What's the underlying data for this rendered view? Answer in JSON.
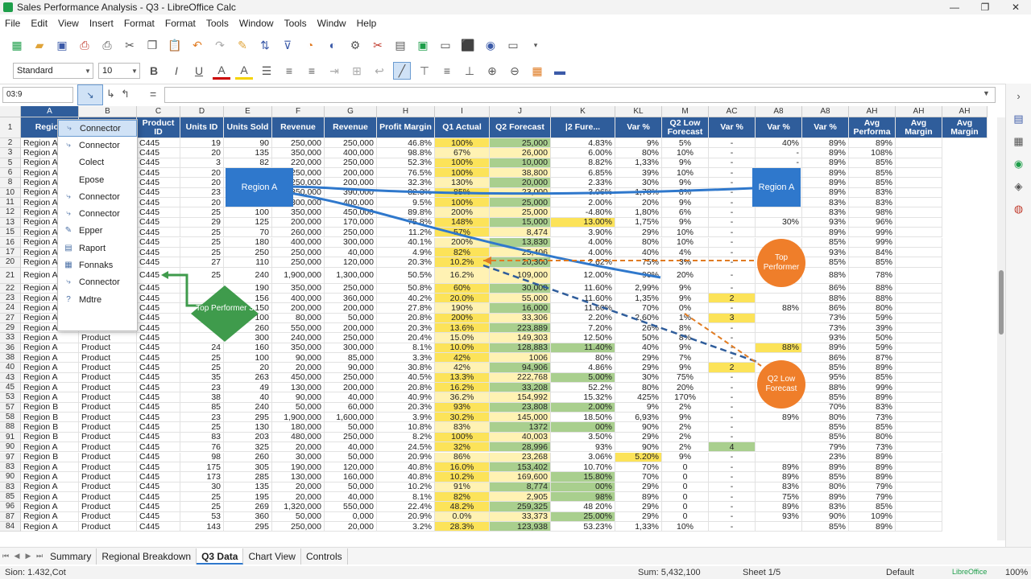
{
  "window": {
    "title": "Sales Performance Analysis - Q3 - LibreOffice Calc"
  },
  "menu": [
    "File",
    "Edit",
    "View",
    "Insert",
    "Format",
    "Format",
    "Tools",
    "Window",
    "Tools",
    "Windw",
    "Help"
  ],
  "toolbar2": {
    "style": "Standard",
    "font_size": "10"
  },
  "formula": {
    "namebox": "03:9",
    "equals": "="
  },
  "columns": [
    "A",
    "B",
    "C",
    "D",
    "E",
    "F",
    "G",
    "H",
    "I",
    "J",
    "K",
    "KL",
    "M",
    "AC",
    "A8",
    "A8",
    "AH",
    "AH",
    "AH"
  ],
  "header_row": [
    "Region",
    "",
    "Product ID",
    "Units ID",
    "Units Sold",
    "Revenue",
    "Revenue",
    "Profit Margin",
    "Q1 Actual",
    "Q2 Forecast",
    "|2 Fure...",
    "Var %",
    "Q2 Low Forecast",
    "Var %",
    "Var %",
    "Var %",
    "Avg Performa",
    "Avg Margin",
    "Avg Margin"
  ],
  "row_numbers": [
    "1",
    "2",
    "3",
    "5",
    "6",
    "8",
    "10",
    "11",
    "12",
    "13",
    "15",
    "16",
    "17",
    "20",
    "21",
    "22",
    "23",
    "24",
    "27",
    "29",
    "33",
    "36",
    "38",
    "40",
    "43",
    "45",
    "53",
    "57",
    "58",
    "88",
    "91",
    "90",
    "97",
    "83",
    "90",
    "83",
    "85",
    "96",
    "87",
    "84"
  ],
  "rows": [
    [
      "Region A",
      "",
      "C445",
      "19",
      "90",
      "250,000",
      "250,000",
      "46.8%",
      "100%",
      "25,000",
      "4.83%",
      "9%",
      "5%",
      "-",
      "40%",
      "89%",
      "89%",
      ""
    ],
    [
      "Region A",
      "",
      "C445",
      "20",
      "135",
      "350,000",
      "400,000",
      "98.8%",
      "67%",
      "26,000",
      "6.00%",
      "80%",
      "10%",
      "-",
      "-",
      "89%",
      "108%",
      ""
    ],
    [
      "Region A",
      "",
      "C445",
      "3",
      "82",
      "220,000",
      "250,000",
      "52.3%",
      "100%",
      "10,000",
      "8.82%",
      "1,33%",
      "9%",
      "-",
      "-",
      "89%",
      "85%",
      ""
    ],
    [
      "Region A",
      "",
      "C445",
      "20",
      "",
      "250,000",
      "200,000",
      "76.5%",
      "100%",
      "38,800",
      "6.85%",
      "39%",
      "10%",
      "-",
      "",
      "89%",
      "85%",
      ""
    ],
    [
      "Region A",
      "",
      "C445",
      "20",
      "",
      "250,000",
      "200,000",
      "32.3%",
      "130%",
      "20,000",
      "2.33%",
      "30%",
      "9%",
      "-",
      "",
      "89%",
      "85%",
      ""
    ],
    [
      "Region A",
      "",
      "C445",
      "23",
      "",
      "350,000",
      "390,000",
      "82.3%",
      "85%",
      "23,000",
      "3.06%",
      "1,78%",
      "8%",
      "-",
      "",
      "89%",
      "83%",
      ""
    ],
    [
      "Region A",
      "",
      "C445",
      "20",
      "",
      "300,000",
      "400,000",
      "9.5%",
      "100%",
      "25,000",
      "2.00%",
      "20%",
      "9%",
      "-",
      "",
      "83%",
      "83%",
      ""
    ],
    [
      "Region A",
      "",
      "C445",
      "25",
      "100",
      "350,000",
      "450,000",
      "89.8%",
      "200%",
      "25,000",
      "-4.80%",
      "1,80%",
      "6%",
      "-",
      "",
      "83%",
      "98%",
      ""
    ],
    [
      "Region A",
      "",
      "C445",
      "29",
      "125",
      "200,000",
      "170,000",
      "75.8%",
      "148%",
      "15,000",
      "13.00%",
      "1,75%",
      "9%",
      "-",
      "30%",
      "93%",
      "96%",
      ""
    ],
    [
      "Region A",
      "",
      "C445",
      "25",
      "70",
      "260,000",
      "250,000",
      "11.2%",
      "57%",
      "8,474",
      "3.90%",
      "29%",
      "10%",
      "-",
      "",
      "89%",
      "99%",
      ""
    ],
    [
      "Region A",
      "",
      "C445",
      "25",
      "180",
      "400,000",
      "300,000",
      "40.1%",
      "200%",
      "13,830",
      "4.00%",
      "80%",
      "10%",
      "-",
      "",
      "85%",
      "99%",
      ""
    ],
    [
      "Region A",
      "",
      "C445",
      "25",
      "250",
      "250,000",
      "40,000",
      "4.9%",
      "82%",
      "25,406",
      "4.00%",
      "40%",
      "4%",
      "-",
      "",
      "93%",
      "84%",
      ""
    ],
    [
      "Region A",
      "",
      "C445",
      "27",
      "110",
      "250,000",
      "120,000",
      "20.3%",
      "10.2%",
      "20,300",
      "2.62%",
      "75%",
      "3%",
      "-",
      "",
      "85%",
      "85%",
      ""
    ],
    [
      "Region A",
      "",
      "C445",
      "25",
      "240",
      "1,900,000",
      "1,300,000",
      "50.5%",
      "16.2%",
      "109,000",
      "12.00%",
      "90%",
      "20%",
      "-",
      "",
      "88%",
      "78%",
      ""
    ],
    [
      "Region A",
      "",
      "C445",
      "",
      "190",
      "350,000",
      "250,000",
      "50.8%",
      "60%",
      "30,000",
      "11.60%",
      "2,99%",
      "9%",
      "-",
      "",
      "86%",
      "88%",
      ""
    ],
    [
      "Region A",
      "",
      "C445",
      "",
      "156",
      "400,000",
      "360,000",
      "40.2%",
      "20.0%",
      "55,000",
      "11.60%",
      "1,35%",
      "9%",
      "2",
      "",
      "88%",
      "88%",
      ""
    ],
    [
      "Region A",
      "",
      "C445",
      "",
      "150",
      "200,000",
      "200,000",
      "27.8%",
      "190%",
      "16,000",
      "11.60%",
      "70%",
      "0%",
      "-",
      "88%",
      "86%",
      "80%",
      ""
    ],
    [
      "Region A",
      "",
      "C445",
      "",
      "100",
      "80,000",
      "50,000",
      "20.8%",
      "200%",
      "33,306",
      "2.20%",
      "2,60%",
      "1%",
      "3",
      "",
      "73%",
      "59%",
      ""
    ],
    [
      "Region A",
      "Product",
      "C445",
      "",
      "260",
      "550,000",
      "200,000",
      "20.3%",
      "13.6%",
      "223,889",
      "7.20%",
      "26%",
      "8%",
      "-",
      "",
      "73%",
      "39%",
      ""
    ],
    [
      "Region A",
      "Product",
      "C445",
      "",
      "300",
      "240,000",
      "250,000",
      "20.4%",
      "15.0%",
      "149,303",
      "12.50%",
      "50%",
      "8%",
      "-",
      "",
      "93%",
      "50%",
      ""
    ],
    [
      "Region A",
      "Product",
      "C445",
      "24",
      "160",
      "350,000",
      "300,000",
      "8.1%",
      "10.0%",
      "128,883",
      "11.40%",
      "40%",
      "9%",
      "-",
      "88%",
      "89%",
      "59%",
      ""
    ],
    [
      "Region A",
      "Product",
      "C445",
      "25",
      "100",
      "90,000",
      "85,000",
      "3.3%",
      "42%",
      "1006",
      "80%",
      "29%",
      "7%",
      "-",
      "",
      "86%",
      "87%",
      ""
    ],
    [
      "Region A",
      "Product",
      "C445",
      "25",
      "20",
      "20,000",
      "90,000",
      "30.8%",
      "42%",
      "94,906",
      "4.86%",
      "29%",
      "9%",
      "2",
      "",
      "85%",
      "89%",
      ""
    ],
    [
      "Region A",
      "Product",
      "C445",
      "35",
      "263",
      "450,000",
      "250,000",
      "40.5%",
      "13.3%",
      "222,768",
      "5.00%",
      "30%",
      "75%",
      "-",
      "",
      "95%",
      "85%",
      ""
    ],
    [
      "Region A",
      "Product",
      "C445",
      "23",
      "49",
      "130,000",
      "200,000",
      "20.8%",
      "16.2%",
      "33,208",
      "52.2%",
      "80%",
      "20%",
      "-",
      "",
      "88%",
      "99%",
      ""
    ],
    [
      "Region A",
      "Product",
      "C445",
      "38",
      "40",
      "90,000",
      "40,000",
      "40.9%",
      "36.2%",
      "154,992",
      "15.32%",
      "425%",
      "170%",
      "-",
      "",
      "85%",
      "89%",
      ""
    ],
    [
      "Region B",
      "Product",
      "C445",
      "85",
      "240",
      "50,000",
      "60,000",
      "20.3%",
      "93%",
      "23,808",
      "2.00%",
      "9%",
      "2%",
      "-",
      "",
      "70%",
      "83%",
      ""
    ],
    [
      "Region B",
      "Product",
      "C445",
      "23",
      "295",
      "1,900,000",
      "1,600,000",
      "3.9%",
      "30.2%",
      "145,000",
      "18.50%",
      "6,93%",
      "9%",
      "-",
      "89%",
      "80%",
      "73%",
      ""
    ],
    [
      "Region B",
      "Product",
      "C445",
      "25",
      "130",
      "180,000",
      "50,000",
      "10.8%",
      "83%",
      "1372",
      "00%",
      "90%",
      "2%",
      "-",
      "",
      "85%",
      "85%",
      ""
    ],
    [
      "Region B",
      "Product",
      "C445",
      "83",
      "203",
      "480,000",
      "250,000",
      "8.2%",
      "100%",
      "40,003",
      "3.50%",
      "29%",
      "2%",
      "-",
      "",
      "85%",
      "80%",
      ""
    ],
    [
      "Region A",
      "Product",
      "C445",
      "76",
      "325",
      "20,000",
      "40,000",
      "24.5%",
      "32%",
      "28,996",
      "93%",
      "90%",
      "2%",
      "4",
      "",
      "79%",
      "73%",
      ""
    ],
    [
      "Region B",
      "Product",
      "C445",
      "98",
      "260",
      "30,000",
      "50,000",
      "20.9%",
      "86%",
      "23,268",
      "3.06%",
      "5.20%",
      "9%",
      "-",
      "",
      "23%",
      "89%",
      ""
    ],
    [
      "Region A",
      "Product",
      "C445",
      "175",
      "305",
      "190,000",
      "120,000",
      "40.8%",
      "16.0%",
      "153,402",
      "10.70%",
      "70%",
      "0",
      "-",
      "89%",
      "89%",
      "89%",
      ""
    ],
    [
      "Region A",
      "Product",
      "C445",
      "173",
      "285",
      "130,000",
      "160,000",
      "40.8%",
      "10.2%",
      "169,600",
      "15.80%",
      "70%",
      "0",
      "-",
      "89%",
      "85%",
      "89%",
      ""
    ],
    [
      "Region A",
      "Product",
      "C445",
      "30",
      "135",
      "20,000",
      "50,000",
      "10.2%",
      "91%",
      "8,774",
      "00%",
      "29%",
      "0",
      "-",
      "83%",
      "80%",
      "79%",
      ""
    ],
    [
      "Region A",
      "Product",
      "C445",
      "25",
      "195",
      "20,000",
      "40,000",
      "8.1%",
      "82%",
      "2,905",
      "98%",
      "89%",
      "0",
      "-",
      "75%",
      "89%",
      "79%",
      ""
    ],
    [
      "Region A",
      "Product",
      "C445",
      "25",
      "269",
      "1,320,000",
      "550,000",
      "22.4%",
      "48.2%",
      "259,325",
      "48 20%",
      "29%",
      "0",
      "-",
      "89%",
      "83%",
      "85%",
      ""
    ],
    [
      "Region A",
      "Product",
      "C445",
      "53",
      "360",
      "50,000",
      "0,000",
      "20.9%",
      "0.0%",
      "33,373",
      "25.00%",
      "29%",
      "0",
      "-",
      "93%",
      "90%",
      "109%",
      ""
    ],
    [
      "Region A",
      "Product",
      "C445",
      "143",
      "295",
      "250,000",
      "20,000",
      "3.2%",
      "28.3%",
      "123,938",
      "53.23%",
      "1,33%",
      "10%",
      "-",
      "",
      "85%",
      "89%",
      ""
    ]
  ],
  "popup_items": [
    {
      "label": "Connector",
      "icon": "connector-icon",
      "active": true
    },
    {
      "label": "Connector",
      "icon": "connector-icon"
    },
    {
      "label": "Colect",
      "icon": ""
    },
    {
      "label": "Epose",
      "icon": ""
    },
    {
      "label": "Connector",
      "icon": "connector-icon"
    },
    {
      "label": "Connector",
      "icon": "connector-icon"
    },
    {
      "label": "Epper",
      "icon": "edit-icon"
    },
    {
      "label": "Raport",
      "icon": "report-icon"
    },
    {
      "label": "Fonnaks",
      "icon": "format-icon"
    },
    {
      "label": "Connector",
      "icon": "connector-icon"
    },
    {
      "label": "Mdtre",
      "icon": "help-icon"
    }
  ],
  "shapes": {
    "region_a_left": "Region A",
    "region_a_right": "Region A",
    "top_performer_circle": "Top Performer",
    "q2_low_forecast_circle": "Q2 Low Forecast",
    "top_performer_diamond": "Top Performer 3"
  },
  "tabs": [
    "Summary",
    "Regional Breakdown",
    "Q3 Data",
    "Chart View",
    "Controls"
  ],
  "active_tab": "Q3 Data",
  "status": {
    "left": "Sion: 1.432,Cot",
    "sum": "Sum: 5,432,100",
    "sheet": "Sheet 1/5",
    "style": "Default",
    "brand": "LibreOffice",
    "zoom": "100%"
  },
  "colors": {
    "header_blue": "#2f5d9b",
    "yellow": "#fce359",
    "light_yellow": "#fff2b3",
    "green": "#a9cf8e",
    "orange": "#ef7e2a",
    "shape_blue": "#2f78cc",
    "diamond_green": "#3f9b4c"
  }
}
